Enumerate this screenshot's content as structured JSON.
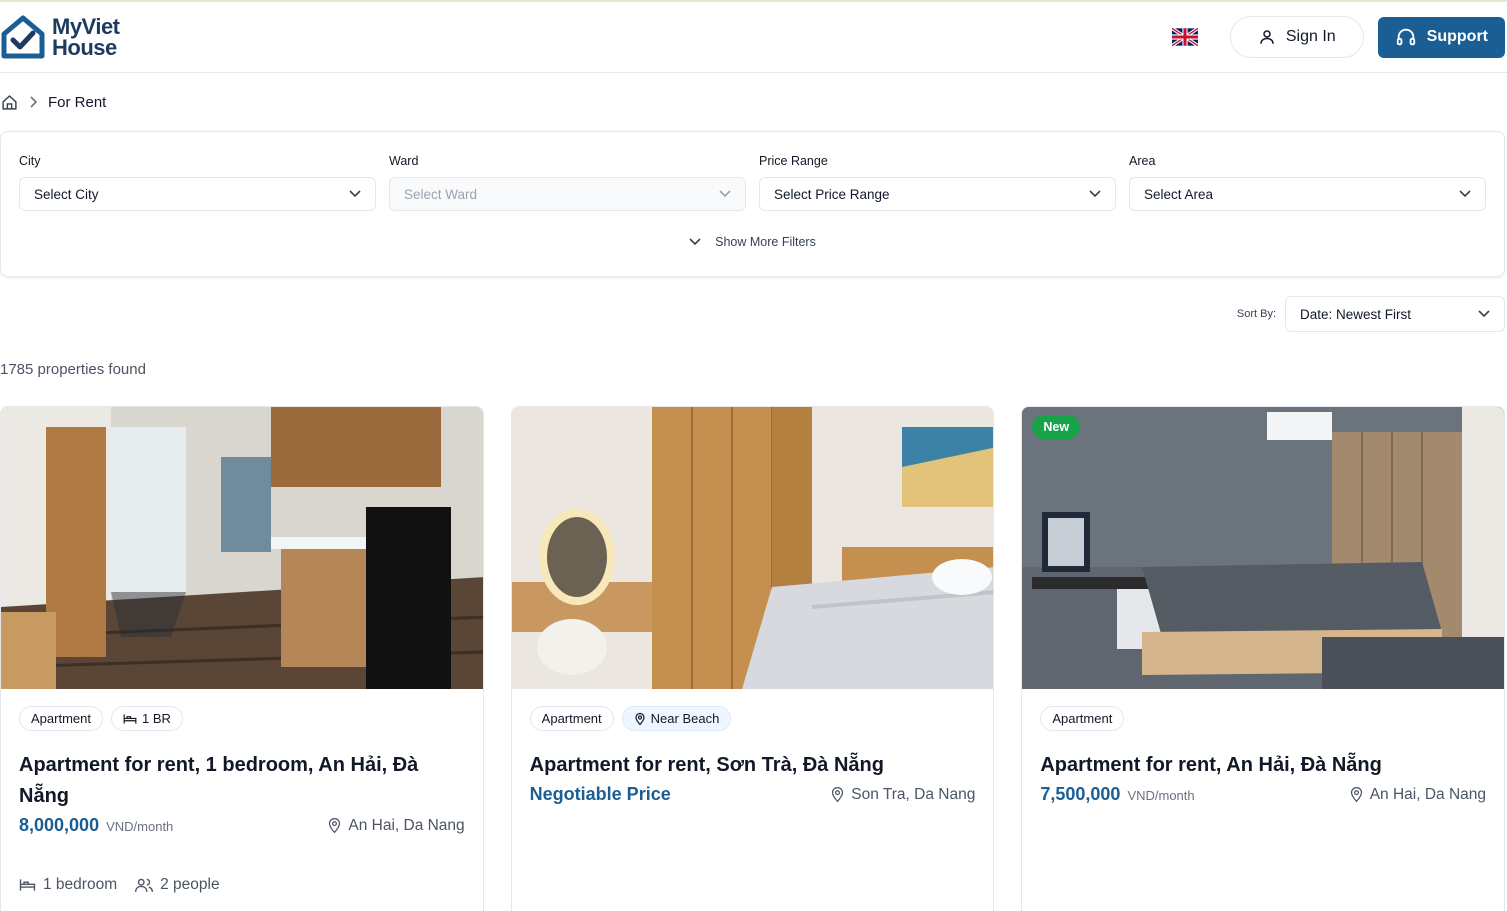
{
  "header": {
    "logo_line1": "MyViet",
    "logo_line2": "House",
    "signin_label": "Sign In",
    "support_label": "Support"
  },
  "breadcrumb": {
    "current": "For Rent"
  },
  "filters": [
    {
      "label": "City",
      "value": "Select City",
      "disabled": false
    },
    {
      "label": "Ward",
      "value": "Select Ward",
      "disabled": true
    },
    {
      "label": "Price Range",
      "value": "Select Price Range",
      "disabled": false
    },
    {
      "label": "Area",
      "value": "Select Area",
      "disabled": false
    }
  ],
  "more_filters_label": "Show More Filters",
  "sort": {
    "label": "Sort By:",
    "value": "Date: Newest First"
  },
  "results_count": "1785 properties found",
  "cards": [
    {
      "tags": [
        "Apartment",
        "1 BR"
      ],
      "title": "Apartment for rent, 1 bedroom, An Hải, Đà Nẵng",
      "price": "8,000,000",
      "unit": "VND/month",
      "location": "An Hai, Da Nang",
      "bedrooms": "1 bedroom",
      "people": "2 people",
      "new": false
    },
    {
      "tags": [
        "Apartment",
        "Near Beach"
      ],
      "title": "Apartment for rent, Sơn Trà, Đà Nẵng",
      "price": "Negotiable Price",
      "unit": "",
      "location": "Son Tra, Da Nang",
      "new": false
    },
    {
      "tags": [
        "Apartment"
      ],
      "title": "Apartment for rent, An Hải, Đà Nẵng",
      "price": "7,500,000",
      "unit": "VND/month",
      "location": "An Hai, Da Nang",
      "badge": "New",
      "new": true
    }
  ]
}
